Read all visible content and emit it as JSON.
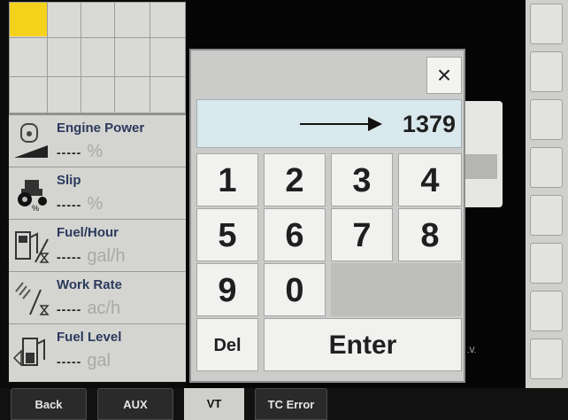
{
  "metrics": [
    {
      "label": "Engine Power",
      "dashes": "-----",
      "unit": "%",
      "icon": "engine-icon"
    },
    {
      "label": "Slip",
      "dashes": "-----",
      "unit": "%",
      "icon": "tractor-slip-icon"
    },
    {
      "label": "Fuel/Hour",
      "dashes": "-----",
      "unit": "gal/h",
      "icon": "fuel-pump-icon"
    },
    {
      "label": "Work Rate",
      "dashes": "-----",
      "unit": "ac/h",
      "icon": "work-rate-icon"
    },
    {
      "label": "Fuel Level",
      "dashes": "-----",
      "unit": "gal",
      "icon": "fuel-level-icon"
    }
  ],
  "keypad": {
    "close_label": "×",
    "display_value": "1379",
    "keys": [
      "1",
      "2",
      "3",
      "4",
      "5",
      "6",
      "7",
      "8",
      "9",
      "0"
    ],
    "del_label": "Del",
    "enter_label": "Enter"
  },
  "background_label": ".V.",
  "tabs": [
    {
      "label": "Back"
    },
    {
      "label": "AUX"
    },
    {
      "label": "VT"
    },
    {
      "label": "TC Error"
    }
  ],
  "colors": {
    "accent_yellow": "#f4d21c",
    "label_navy": "#2b3a5c",
    "display_bg": "#d9e8ec"
  }
}
